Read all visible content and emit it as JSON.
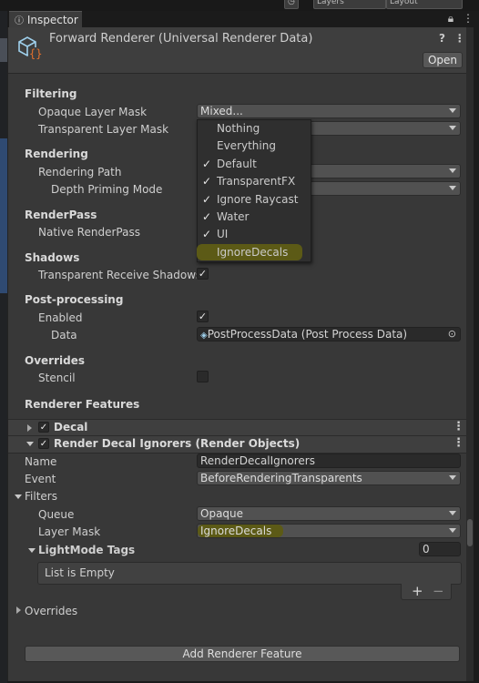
{
  "window": {
    "tab_label": "Inspector",
    "top_buttons": [
      "Layers",
      "Layout"
    ]
  },
  "header": {
    "title": "Forward Renderer (Universal Renderer Data)",
    "open_label": "Open"
  },
  "filtering": {
    "section": "Filtering",
    "opaque_label": "Opaque Layer Mask",
    "opaque_value": "Mixed...",
    "transparent_label": "Transparent Layer Mask"
  },
  "layer_menu": [
    {
      "label": "Nothing",
      "checked": false
    },
    {
      "label": "Everything",
      "checked": false
    },
    {
      "label": "Default",
      "checked": true
    },
    {
      "label": "TransparentFX",
      "checked": true
    },
    {
      "label": "Ignore Raycast",
      "checked": true
    },
    {
      "label": "Water",
      "checked": true
    },
    {
      "label": "UI",
      "checked": true
    },
    {
      "label": "IgnoreDecals",
      "checked": false,
      "highlighted": true
    }
  ],
  "rendering": {
    "section": "Rendering",
    "path_label": "Rendering Path",
    "depth_label": "Depth Priming Mode"
  },
  "renderpass": {
    "section": "RenderPass",
    "native_label": "Native RenderPass"
  },
  "shadows": {
    "section": "Shadows",
    "receive_label": "Transparent Receive Shadows",
    "receive_checked": true
  },
  "postprocessing": {
    "section": "Post-processing",
    "enabled_label": "Enabled",
    "enabled_checked": true,
    "data_label": "Data",
    "data_value": "PostProcessData (Post Process Data)"
  },
  "overrides": {
    "section": "Overrides",
    "stencil_label": "Stencil",
    "stencil_checked": false
  },
  "features": {
    "section": "Renderer Features",
    "decal_label": "Decal",
    "render_objects_label": "Render Decal Ignorers (Render Objects)",
    "name_label": "Name",
    "name_value": "RenderDecalIgnorers",
    "event_label": "Event",
    "event_value": "BeforeRenderingTransparents",
    "filters_label": "Filters",
    "queue_label": "Queue",
    "queue_value": "Opaque",
    "layermask_label": "Layer Mask",
    "layermask_value": "IgnoreDecals",
    "lightmode_label": "LightMode Tags",
    "lightmode_count": "0",
    "list_empty": "List is Empty",
    "plus": "+",
    "minus": "−",
    "overrides_label": "Overrides",
    "add_label": "Add Renderer Feature"
  },
  "colors": {
    "panel": "#383838",
    "highlight": "#5c5a16",
    "accent_icon": "#e0702e"
  }
}
